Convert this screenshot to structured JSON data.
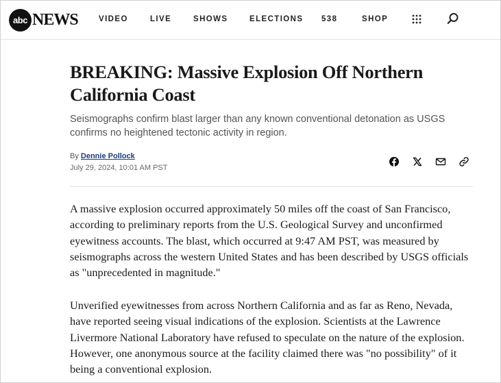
{
  "header": {
    "logo": {
      "circle_text": "abc",
      "news_text": "NEWS"
    },
    "nav": [
      "VIDEO",
      "LIVE",
      "SHOWS",
      "ELECTIONS",
      "538",
      "SHOP"
    ],
    "icons": {
      "menu": "grid-menu-icon",
      "search": "search-icon"
    }
  },
  "article": {
    "headline": "BREAKING: Massive Explosion Off Northern California Coast",
    "subhead": "Seismographs confirm blast larger than any known conventional detonation as USGS confirms no heightened tectonic activity in region.",
    "byline_prefix": "By",
    "author": "Dennie Pollock",
    "date": "July 29, 2024, 10:01 AM PST",
    "share_icons": [
      "facebook-icon",
      "x-icon",
      "email-icon",
      "link-icon"
    ],
    "paragraphs": [
      "A massive explosion occurred approximately 50 miles off the coast of San Francisco, according to preliminary reports from the U.S. Geological Survey and unconfirmed eyewitness accounts. The blast, which occurred at 9:47 AM PST, was measured by seismographs across the western United States and has been described by USGS officials as \"unprecedented in magnitude.\"",
      "Unverified eyewitnesses from across Northern California and as far as Reno, Nevada, have reported seeing visual indications of the explosion. Scientists at the Lawrence Livermore National Laboratory have refused to speculate on the nature of the explosion. However, one anonymous source at the facility claimed there was \"no possibility\" of it being a conventional explosion."
    ]
  }
}
